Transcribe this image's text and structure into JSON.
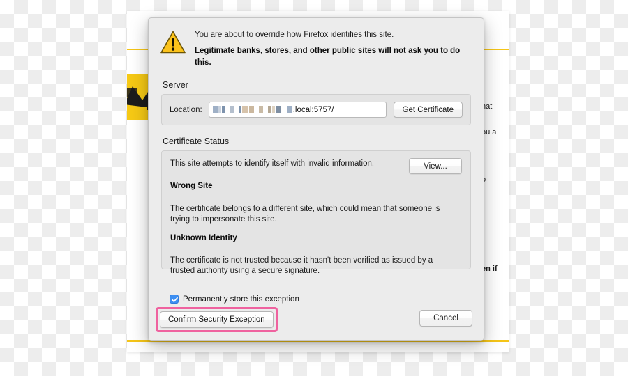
{
  "dialog": {
    "warning_icon": "warning-triangle-icon",
    "header_line_1": "You are about to override how Firefox identifies this site.",
    "header_line_2": "Legitimate banks, stores, and other public sites will not ask you to do this.",
    "server": {
      "section_title": "Server",
      "location_label": "Location:",
      "location_value_redacted": "███ █ █████ █ ████ █",
      "location_value_tail": ".local:5757/",
      "get_certificate_label": "Get Certificate"
    },
    "certificate_status": {
      "section_title": "Certificate Status",
      "summary": "This site attempts to identify itself with invalid information.",
      "view_button_label": "View...",
      "issue_1_heading": "Wrong Site",
      "issue_1_body": "The certificate belongs to a different site, which could mean that someone is trying to impersonate this site.",
      "issue_2_heading": "Unknown Identity",
      "issue_2_body": "The certificate is not trusted because it hasn't been verified as issued by a trusted authority using a secure signature."
    },
    "permanently_store_label": "Permanently store this exception",
    "permanently_store_checked": true,
    "confirm_label": "Confirm Security Exception",
    "cancel_label": "Cancel"
  },
  "background_page": {
    "text_fragments": [
      "hat",
      "ou a",
      "o",
      "en if"
    ],
    "warning_badge_icon": "yellow-warning-badge-icon"
  },
  "colors": {
    "highlight_pink": "#ef629f",
    "warning_yellow": "#f6c915",
    "checkbox_blue": "#3d8ff2",
    "rule_yellow": "#f5c518",
    "dialog_bg": "#ececec",
    "group_bg": "#e4e4e4"
  }
}
